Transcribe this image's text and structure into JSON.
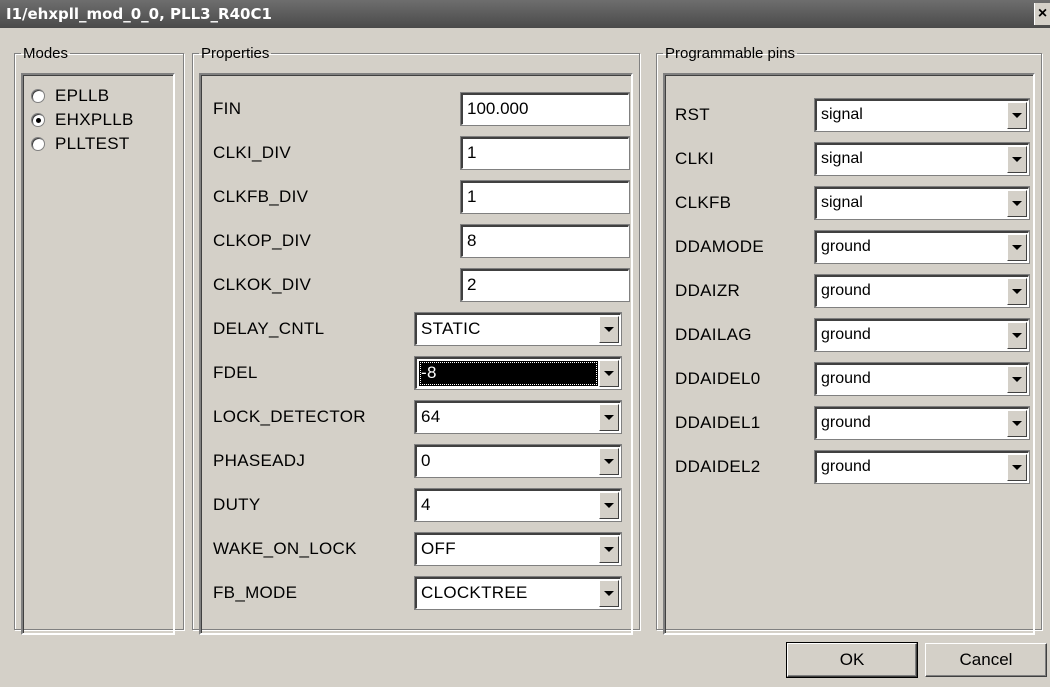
{
  "window": {
    "title": "I1/ehxpll_mod_0_0, PLL3_R40C1",
    "close_label": "×"
  },
  "modes": {
    "legend": "Modes",
    "options": [
      {
        "label": "EPLLB",
        "checked": false
      },
      {
        "label": "EHXPLLB",
        "checked": true
      },
      {
        "label": "PLLTEST",
        "checked": false
      }
    ]
  },
  "properties": {
    "legend": "Properties",
    "text_fields": [
      {
        "label": "FIN",
        "value": "100.000"
      },
      {
        "label": "CLKI_DIV",
        "value": "1"
      },
      {
        "label": "CLKFB_DIV",
        "value": "1"
      },
      {
        "label": "CLKOP_DIV",
        "value": "8"
      },
      {
        "label": "CLKOK_DIV",
        "value": "2"
      }
    ],
    "select_fields": [
      {
        "label": "DELAY_CNTL",
        "value": "STATIC"
      },
      {
        "label": "FDEL",
        "value": "-8",
        "focused": true
      },
      {
        "label": "LOCK_DETECTOR",
        "value": "64"
      },
      {
        "label": "PHASEADJ",
        "value": "0"
      },
      {
        "label": "DUTY",
        "value": "4"
      },
      {
        "label": "WAKE_ON_LOCK",
        "value": "OFF"
      },
      {
        "label": "FB_MODE",
        "value": "CLOCKTREE"
      }
    ]
  },
  "pins": {
    "legend": "Programmable pins",
    "items": [
      {
        "label": "RST",
        "value": "signal"
      },
      {
        "label": "CLKI",
        "value": "signal"
      },
      {
        "label": "CLKFB",
        "value": "signal"
      },
      {
        "label": "DDAMODE",
        "value": "ground"
      },
      {
        "label": "DDAIZR",
        "value": "ground"
      },
      {
        "label": "DDAILAG",
        "value": "ground"
      },
      {
        "label": "DDAIDEL0",
        "value": "ground"
      },
      {
        "label": "DDAIDEL1",
        "value": "ground"
      },
      {
        "label": "DDAIDEL2",
        "value": "ground"
      }
    ]
  },
  "buttons": {
    "ok": "OK",
    "cancel": "Cancel"
  }
}
